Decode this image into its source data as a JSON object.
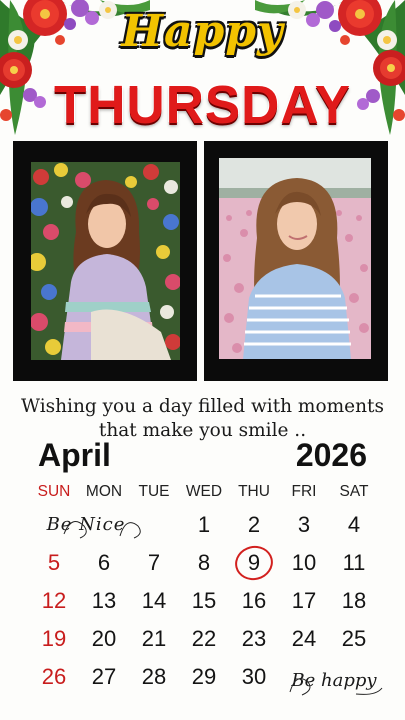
{
  "header": {
    "greeting": "Happy",
    "day": "THURSDAY"
  },
  "message": {
    "line1": "Wishing you a day filled with moments",
    "line2": "that make you smile .."
  },
  "calendar": {
    "month": "April",
    "year": "2026",
    "weekdays": [
      "SUN",
      "MON",
      "TUE",
      "WED",
      "THU",
      "FRI",
      "SAT"
    ],
    "rows": [
      [
        "",
        "",
        "",
        "1",
        "2",
        "3",
        "4"
      ],
      [
        "5",
        "6",
        "7",
        "8",
        "9",
        "10",
        "11"
      ],
      [
        "12",
        "13",
        "14",
        "15",
        "16",
        "17",
        "18"
      ],
      [
        "19",
        "20",
        "21",
        "22",
        "23",
        "24",
        "25"
      ],
      [
        "26",
        "27",
        "28",
        "29",
        "30",
        "",
        ""
      ]
    ],
    "highlighted_day": "9",
    "start_note": "Be Nice",
    "end_note": "Be happy"
  },
  "colors": {
    "accent_red": "#e01a1a",
    "sunday_red": "#c81d1d",
    "gold": "#f2c200",
    "frame_black": "#0b0b0b"
  },
  "icons": [
    "flower-cluster-left",
    "flower-cluster-right"
  ]
}
